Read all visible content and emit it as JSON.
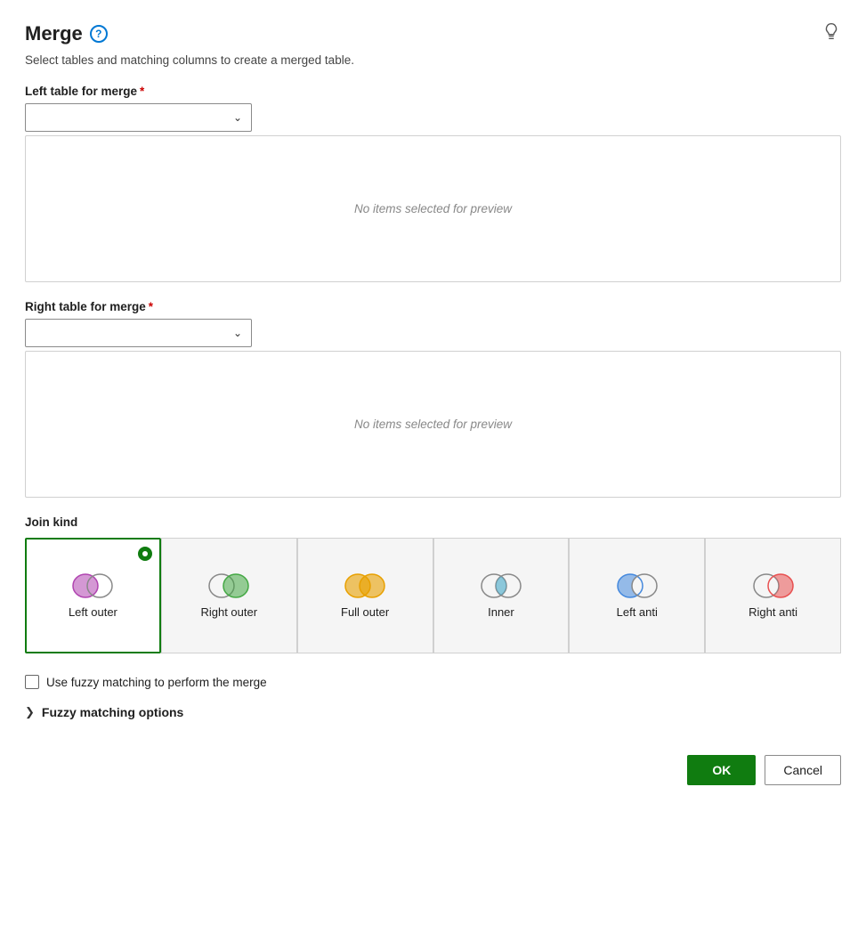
{
  "header": {
    "title": "Merge",
    "subtitle": "Select tables and matching columns to create a merged table.",
    "help_icon": "?",
    "lightbulb_icon": "💡"
  },
  "left_table": {
    "label": "Left table for merge",
    "required": true,
    "placeholder": "",
    "preview_empty": "No items selected for preview"
  },
  "right_table": {
    "label": "Right table for merge",
    "required": true,
    "placeholder": "",
    "preview_empty": "No items selected for preview"
  },
  "join_kind": {
    "label": "Join kind",
    "options": [
      {
        "id": "left-outer",
        "label": "Left outer",
        "selected": true
      },
      {
        "id": "right-outer",
        "label": "Right outer",
        "selected": false
      },
      {
        "id": "full-outer",
        "label": "Full outer",
        "selected": false
      },
      {
        "id": "inner",
        "label": "Inner",
        "selected": false
      },
      {
        "id": "left-anti",
        "label": "Left anti",
        "selected": false
      },
      {
        "id": "right-anti",
        "label": "Right anti",
        "selected": false
      }
    ]
  },
  "fuzzy": {
    "checkbox_label": "Use fuzzy matching to perform the merge",
    "options_label": "Fuzzy matching options"
  },
  "buttons": {
    "ok": "OK",
    "cancel": "Cancel"
  }
}
